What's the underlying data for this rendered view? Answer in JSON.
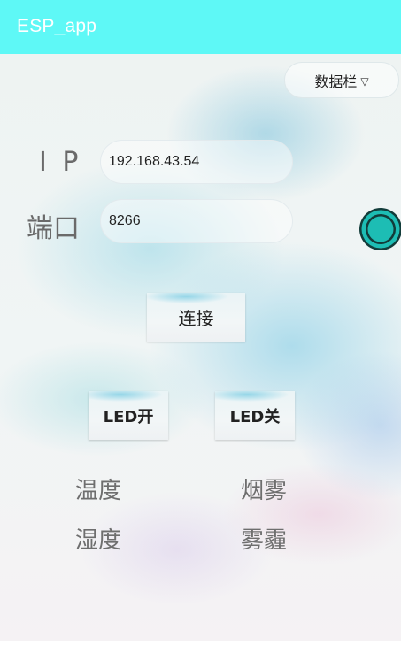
{
  "app": {
    "title": "ESP_app"
  },
  "dropdown": {
    "label": "数据栏",
    "arrow": "▽"
  },
  "connection": {
    "ip_label": "I P",
    "ip_value": "192.168.43.54",
    "port_label": "端口",
    "port_value": "8266",
    "connect_label": "连接"
  },
  "led": {
    "on_label": "LED开",
    "off_label": "LED关"
  },
  "sensors": {
    "temperature": "温度",
    "smoke": "烟雾",
    "humidity": "湿度",
    "haze": "雾霾"
  },
  "colors": {
    "appbar": "#5ef8f6",
    "radio_fill": "#1dbdb4",
    "radio_ring": "#123c3a"
  }
}
